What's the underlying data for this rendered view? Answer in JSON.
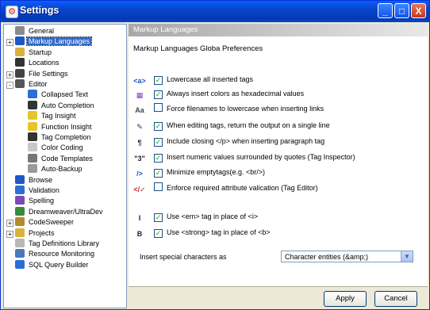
{
  "window": {
    "title": "Settings",
    "icon": "settings-app-icon",
    "controls": {
      "minimize": "_",
      "maximize": "□",
      "close": "X"
    }
  },
  "tree": {
    "items": [
      {
        "label": "General",
        "icon": "gear-icon",
        "color": "#8a8a8a",
        "level": 0,
        "expander": ""
      },
      {
        "label": "Markup Languages",
        "icon": "markup-icon",
        "color": "#1e57c6",
        "level": 0,
        "expander": "+",
        "selected": true
      },
      {
        "label": "Startup",
        "icon": "folder-icon",
        "color": "#d8b23d",
        "level": 0,
        "expander": ""
      },
      {
        "label": "Locations",
        "icon": "disk-icon",
        "color": "#333333",
        "level": 0,
        "expander": ""
      },
      {
        "label": "File Settings",
        "icon": "file-icon",
        "color": "#444444",
        "level": 0,
        "expander": "+"
      },
      {
        "label": "Editor",
        "icon": "editor-icon",
        "color": "#555555",
        "level": 0,
        "expander": "-"
      },
      {
        "label": "Collapsed Text",
        "icon": "collapse-icon",
        "color": "#2a6fd6",
        "level": 1,
        "expander": ""
      },
      {
        "label": "Auto Completion",
        "icon": "binoculars-icon",
        "color": "#333333",
        "level": 1,
        "expander": ""
      },
      {
        "label": "Tag Insight",
        "icon": "bulb-icon",
        "color": "#e6c52b",
        "level": 1,
        "expander": ""
      },
      {
        "label": "Function Insight",
        "icon": "bulb-icon",
        "color": "#e6c52b",
        "level": 1,
        "expander": ""
      },
      {
        "label": "Tag Completion",
        "icon": "binoculars-icon",
        "color": "#333333",
        "level": 1,
        "expander": ""
      },
      {
        "label": "Color Coding",
        "icon": "page-icon",
        "color": "#c8c8c8",
        "level": 1,
        "expander": ""
      },
      {
        "label": "Code Templates",
        "icon": "templates-icon",
        "color": "#777777",
        "level": 1,
        "expander": ""
      },
      {
        "label": "Auto-Backup",
        "icon": "backup-icon",
        "color": "#9a9a9a",
        "level": 1,
        "expander": ""
      },
      {
        "label": "Browse",
        "icon": "browse-icon",
        "color": "#1e57c6",
        "level": 0,
        "expander": ""
      },
      {
        "label": "Validation",
        "icon": "validation-icon",
        "color": "#2a6fd6",
        "level": 0,
        "expander": ""
      },
      {
        "label": "Spelling",
        "icon": "spelling-icon",
        "color": "#7b4bb8",
        "level": 0,
        "expander": ""
      },
      {
        "label": "Dreamweaver/UltraDev",
        "icon": "dreamweaver-icon",
        "color": "#3a8a3a",
        "level": 0,
        "expander": ""
      },
      {
        "label": "CodeSweeper",
        "icon": "sweeper-icon",
        "color": "#b58a2a",
        "level": 0,
        "expander": "+"
      },
      {
        "label": "Projects",
        "icon": "projects-icon",
        "color": "#d8b23d",
        "level": 0,
        "expander": "+"
      },
      {
        "label": "Tag Definitions Library",
        "icon": "library-icon",
        "color": "#b8b8b8",
        "level": 0,
        "expander": ""
      },
      {
        "label": "Resource Monitoring",
        "icon": "monitor-icon",
        "color": "#4a7ab8",
        "level": 0,
        "expander": ""
      },
      {
        "label": "SQL Query Builder",
        "icon": "sql-icon",
        "color": "#2a6fd6",
        "level": 0,
        "expander": ""
      }
    ]
  },
  "panel": {
    "header": "Markup Languages",
    "subtitle": "Markup Languages Globa Preferences",
    "options": [
      {
        "icon_glyph": "<a>",
        "icon": "anchor-tag-icon",
        "icon_color": "#1e57c6",
        "label": "Lowercase all inserted tags",
        "checked": true
      },
      {
        "icon_glyph": "▦",
        "icon": "color-palette-icon",
        "icon_color": "#7b3fb0",
        "label": "Always insert colors as hexadecimal values",
        "checked": true
      },
      {
        "icon_glyph": "Aa",
        "icon": "case-icon",
        "icon_color": "#444444",
        "label": "Force filenames to lowercase when inserting links",
        "checked": false
      },
      {
        "icon_glyph": "✎",
        "icon": "edit-tag-icon",
        "icon_color": "#333333",
        "label": "When editing tags, return the output on a single line",
        "checked": true
      },
      {
        "icon_glyph": "¶",
        "icon": "paragraph-icon",
        "icon_color": "#222222",
        "label": "Include closing </p> when inserting paragraph tag",
        "checked": true
      },
      {
        "icon_glyph": "\"3\"",
        "icon": "quotes-icon",
        "icon_color": "#222222",
        "label": "Insert numeric values surrounded by quotes (Tag Inspector)",
        "checked": true
      },
      {
        "icon_glyph": "/>",
        "icon": "empty-tag-icon",
        "icon_color": "#1e57c6",
        "label": "Minimize emptytags(e.g. <br/>)",
        "checked": true
      },
      {
        "icon_glyph": "</✓",
        "icon": "validate-tag-icon",
        "icon_color": "#c22222",
        "label": "Enforce required attribute valication  (Tag Editor)",
        "checked": false
      },
      {
        "icon_glyph": "I",
        "icon": "italic-icon",
        "icon_color": "#222222",
        "label": "Use <em> tag in place of <i>",
        "checked": true
      },
      {
        "icon_glyph": "B",
        "icon": "bold-icon",
        "icon_color": "#222222",
        "label": "Use <strong> tag in place of <b>",
        "checked": true
      }
    ],
    "insert_special_label": "Insert  special characters as",
    "insert_special_value": "Character entities  (&amp;)"
  },
  "buttons": {
    "apply": "Apply",
    "cancel": "Cancel"
  }
}
